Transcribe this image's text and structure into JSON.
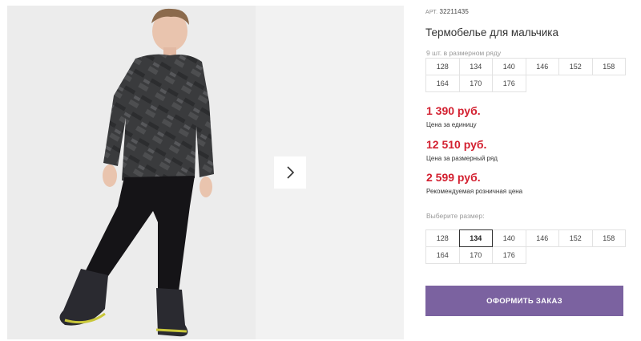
{
  "product": {
    "art_label": "АРТ.",
    "art_number": "32211435",
    "title": "Термобелье для мальчика",
    "image_alt": "Мальчик в термобелье"
  },
  "size_row": {
    "label": "9 шт. в размерном ряду",
    "sizes": [
      "128",
      "134",
      "140",
      "146",
      "152",
      "158",
      "164",
      "170",
      "176"
    ]
  },
  "prices": [
    {
      "value": "1 390 руб.",
      "note": "Цена за единицу"
    },
    {
      "value": "12 510 руб.",
      "note": "Цена за размерный ряд"
    },
    {
      "value": "2 599 руб.",
      "note": "Рекомендуемая розничная цена"
    }
  ],
  "size_choice": {
    "label": "Выберите размер:",
    "sizes": [
      "128",
      "134",
      "140",
      "146",
      "152",
      "158",
      "164",
      "170",
      "176"
    ],
    "selected": "134"
  },
  "order_button": {
    "label": "ОФОРМИТЬ ЗАКАЗ"
  },
  "colors": {
    "price": "#d32030",
    "button": "#7b62a0"
  },
  "icons": {
    "next": "chevron-right-icon"
  }
}
